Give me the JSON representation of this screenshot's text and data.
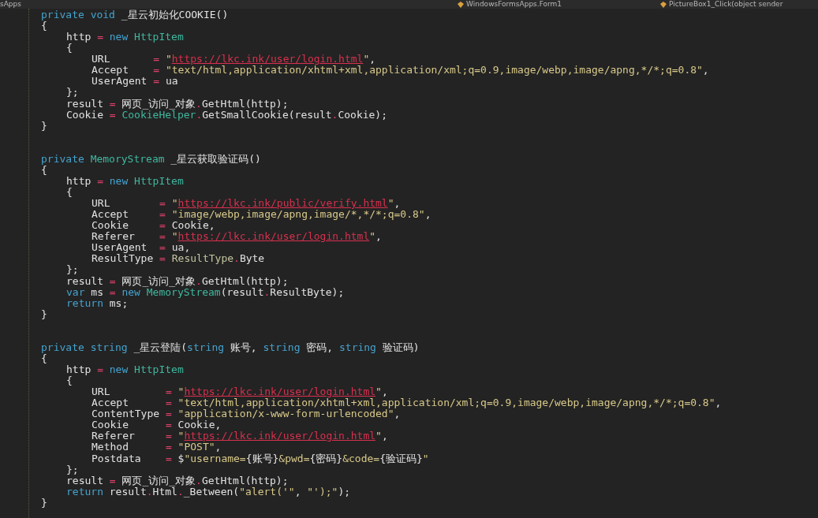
{
  "navigation_bar": [
    {
      "label": "sApps",
      "icon": false
    },
    {
      "label": "WindowsFormsApps.Form1",
      "icon": true
    },
    {
      "label": "PictureBox1_Click(object sender",
      "icon": true
    }
  ],
  "methods": [
    {
      "lines": [
        {
          "tokens": [
            {
              "kind": "kw",
              "text": "private "
            },
            {
              "kind": "kw",
              "text": "void"
            },
            {
              "kind": "plain",
              "text": " _星云初始化COOKIE()"
            }
          ]
        },
        {
          "tokens": [
            {
              "kind": "plain",
              "text": "{"
            }
          ],
          "children": [
            {
              "tokens": [
                {
                  "kind": "plain",
                  "text": "http"
                },
                {
                  "kind": "op",
                  "text": " = "
                },
                {
                  "kind": "kw",
                  "text": "new "
                },
                {
                  "kind": "type",
                  "text": "HttpItem"
                }
              ]
            },
            {
              "tokens": [
                {
                  "kind": "plain",
                  "text": "{"
                }
              ],
              "children": [
                {
                  "tokens": [
                    {
                      "kind": "plain",
                      "text": "URL"
                    },
                    {
                      "kind": "op",
                      "text": "       = "
                    },
                    {
                      "kind": "str",
                      "text": "\""
                    },
                    {
                      "kind": "url",
                      "text": "https://lkc.ink/user/login.html"
                    },
                    {
                      "kind": "str",
                      "text": "\""
                    },
                    {
                      "kind": "plain",
                      "text": ","
                    }
                  ]
                },
                {
                  "tokens": [
                    {
                      "kind": "plain",
                      "text": "Accept"
                    },
                    {
                      "kind": "op",
                      "text": "    = "
                    },
                    {
                      "kind": "str",
                      "text": "\"text/html,application/xhtml+xml,application/xml;q=0.9,image/webp,image/apng,*/*;q=0.8\""
                    },
                    {
                      "kind": "plain",
                      "text": ","
                    }
                  ]
                },
                {
                  "tokens": [
                    {
                      "kind": "plain",
                      "text": "UserAgent"
                    },
                    {
                      "kind": "op",
                      "text": " = "
                    },
                    {
                      "kind": "plain",
                      "text": "ua"
                    }
                  ]
                }
              ]
            },
            {
              "tokens": [
                {
                  "kind": "plain",
                  "text": "};"
                }
              ]
            },
            {
              "tokens": [
                {
                  "kind": "plain",
                  "text": "result"
                },
                {
                  "kind": "op",
                  "text": " = "
                },
                {
                  "kind": "plain",
                  "text": "网页_访问_对象"
                },
                {
                  "kind": "op",
                  "text": "."
                },
                {
                  "kind": "plain",
                  "text": "GetHtml(http);"
                }
              ]
            },
            {
              "tokens": [
                {
                  "kind": "plain",
                  "text": "Cookie"
                },
                {
                  "kind": "op",
                  "text": " = "
                },
                {
                  "kind": "type",
                  "text": "CookieHelper"
                },
                {
                  "kind": "op",
                  "text": "."
                },
                {
                  "kind": "plain",
                  "text": "GetSmallCookie(result"
                },
                {
                  "kind": "op",
                  "text": "."
                },
                {
                  "kind": "plain",
                  "text": "Cookie);"
                }
              ]
            }
          ]
        },
        {
          "tokens": [
            {
              "kind": "plain",
              "text": "}"
            }
          ]
        }
      ]
    },
    {
      "lines": [
        {
          "tokens": [
            {
              "kind": "kw",
              "text": "private "
            },
            {
              "kind": "type",
              "text": "MemoryStream"
            },
            {
              "kind": "plain",
              "text": " _星云获取验证码()"
            }
          ]
        },
        {
          "tokens": [
            {
              "kind": "plain",
              "text": "{"
            }
          ],
          "children": [
            {
              "tokens": [
                {
                  "kind": "plain",
                  "text": "http"
                },
                {
                  "kind": "op",
                  "text": " = "
                },
                {
                  "kind": "kw",
                  "text": "new "
                },
                {
                  "kind": "type",
                  "text": "HttpItem"
                }
              ]
            },
            {
              "tokens": [
                {
                  "kind": "plain",
                  "text": "{"
                }
              ],
              "children": [
                {
                  "tokens": [
                    {
                      "kind": "plain",
                      "text": "URL"
                    },
                    {
                      "kind": "op",
                      "text": "        = "
                    },
                    {
                      "kind": "str",
                      "text": "\""
                    },
                    {
                      "kind": "url",
                      "text": "https://lkc.ink/public/verify.html"
                    },
                    {
                      "kind": "str",
                      "text": "\""
                    },
                    {
                      "kind": "plain",
                      "text": ","
                    }
                  ]
                },
                {
                  "tokens": [
                    {
                      "kind": "plain",
                      "text": "Accept"
                    },
                    {
                      "kind": "op",
                      "text": "     = "
                    },
                    {
                      "kind": "str",
                      "text": "\"image/webp,image/apng,image/*,*/*;q=0.8\""
                    },
                    {
                      "kind": "plain",
                      "text": ","
                    }
                  ]
                },
                {
                  "tokens": [
                    {
                      "kind": "plain",
                      "text": "Cookie"
                    },
                    {
                      "kind": "op",
                      "text": "     = "
                    },
                    {
                      "kind": "plain",
                      "text": "Cookie,"
                    }
                  ]
                },
                {
                  "tokens": [
                    {
                      "kind": "plain",
                      "text": "Referer"
                    },
                    {
                      "kind": "op",
                      "text": "    = "
                    },
                    {
                      "kind": "str",
                      "text": "\""
                    },
                    {
                      "kind": "url",
                      "text": "https://lkc.ink/user/login.html"
                    },
                    {
                      "kind": "str",
                      "text": "\""
                    },
                    {
                      "kind": "plain",
                      "text": ","
                    }
                  ]
                },
                {
                  "tokens": [
                    {
                      "kind": "plain",
                      "text": "UserAgent"
                    },
                    {
                      "kind": "op",
                      "text": "  = "
                    },
                    {
                      "kind": "plain",
                      "text": "ua,"
                    }
                  ]
                },
                {
                  "tokens": [
                    {
                      "kind": "plain",
                      "text": "ResultType"
                    },
                    {
                      "kind": "op",
                      "text": " = "
                    },
                    {
                      "kind": "enum",
                      "text": "ResultType"
                    },
                    {
                      "kind": "op",
                      "text": "."
                    },
                    {
                      "kind": "plain",
                      "text": "Byte"
                    }
                  ]
                }
              ]
            },
            {
              "tokens": [
                {
                  "kind": "plain",
                  "text": "};"
                }
              ]
            },
            {
              "tokens": [
                {
                  "kind": "plain",
                  "text": "result"
                },
                {
                  "kind": "op",
                  "text": " = "
                },
                {
                  "kind": "plain",
                  "text": "网页_访问_对象"
                },
                {
                  "kind": "op",
                  "text": "."
                },
                {
                  "kind": "plain",
                  "text": "GetHtml(http);"
                }
              ]
            },
            {
              "tokens": [
                {
                  "kind": "kw",
                  "text": "var"
                },
                {
                  "kind": "plain",
                  "text": " ms"
                },
                {
                  "kind": "op",
                  "text": " = "
                },
                {
                  "kind": "kw",
                  "text": "new "
                },
                {
                  "kind": "type",
                  "text": "MemoryStream"
                },
                {
                  "kind": "plain",
                  "text": "(result"
                },
                {
                  "kind": "op",
                  "text": "."
                },
                {
                  "kind": "plain",
                  "text": "ResultByte);"
                }
              ]
            },
            {
              "tokens": [
                {
                  "kind": "kw",
                  "text": "return"
                },
                {
                  "kind": "plain",
                  "text": " ms;"
                }
              ]
            }
          ]
        },
        {
          "tokens": [
            {
              "kind": "plain",
              "text": "}"
            }
          ]
        }
      ]
    },
    {
      "lines": [
        {
          "tokens": [
            {
              "kind": "kw",
              "text": "private "
            },
            {
              "kind": "kw",
              "text": "string"
            },
            {
              "kind": "plain",
              "text": " _星云登陆("
            },
            {
              "kind": "kw",
              "text": "string"
            },
            {
              "kind": "plain",
              "text": " 账号, "
            },
            {
              "kind": "kw",
              "text": "string"
            },
            {
              "kind": "plain",
              "text": " 密码, "
            },
            {
              "kind": "kw",
              "text": "string"
            },
            {
              "kind": "plain",
              "text": " 验证码)"
            }
          ]
        },
        {
          "tokens": [
            {
              "kind": "plain",
              "text": "{"
            }
          ],
          "children": [
            {
              "tokens": [
                {
                  "kind": "plain",
                  "text": "http"
                },
                {
                  "kind": "op",
                  "text": " = "
                },
                {
                  "kind": "kw",
                  "text": "new "
                },
                {
                  "kind": "type",
                  "text": "HttpItem"
                }
              ]
            },
            {
              "tokens": [
                {
                  "kind": "plain",
                  "text": "{"
                }
              ],
              "children": [
                {
                  "tokens": [
                    {
                      "kind": "plain",
                      "text": "URL"
                    },
                    {
                      "kind": "op",
                      "text": "         = "
                    },
                    {
                      "kind": "str",
                      "text": "\""
                    },
                    {
                      "kind": "url",
                      "text": "https://lkc.ink/user/login.html"
                    },
                    {
                      "kind": "str",
                      "text": "\""
                    },
                    {
                      "kind": "plain",
                      "text": ","
                    }
                  ]
                },
                {
                  "tokens": [
                    {
                      "kind": "plain",
                      "text": "Accept"
                    },
                    {
                      "kind": "op",
                      "text": "      = "
                    },
                    {
                      "kind": "str",
                      "text": "\"text/html,application/xhtml+xml,application/xml;q=0.9,image/webp,image/apng,*/*;q=0.8\""
                    },
                    {
                      "kind": "plain",
                      "text": ","
                    }
                  ]
                },
                {
                  "tokens": [
                    {
                      "kind": "plain",
                      "text": "ContentType"
                    },
                    {
                      "kind": "op",
                      "text": " = "
                    },
                    {
                      "kind": "str",
                      "text": "\"application/x-www-form-urlencoded\""
                    },
                    {
                      "kind": "plain",
                      "text": ","
                    }
                  ]
                },
                {
                  "tokens": [
                    {
                      "kind": "plain",
                      "text": "Cookie"
                    },
                    {
                      "kind": "op",
                      "text": "      = "
                    },
                    {
                      "kind": "plain",
                      "text": "Cookie,"
                    }
                  ]
                },
                {
                  "tokens": [
                    {
                      "kind": "plain",
                      "text": "Referer"
                    },
                    {
                      "kind": "op",
                      "text": "     = "
                    },
                    {
                      "kind": "str",
                      "text": "\""
                    },
                    {
                      "kind": "url",
                      "text": "https://lkc.ink/user/login.html"
                    },
                    {
                      "kind": "str",
                      "text": "\""
                    },
                    {
                      "kind": "plain",
                      "text": ","
                    }
                  ]
                },
                {
                  "tokens": [
                    {
                      "kind": "plain",
                      "text": "Method"
                    },
                    {
                      "kind": "op",
                      "text": "      = "
                    },
                    {
                      "kind": "str",
                      "text": "\"POST\""
                    },
                    {
                      "kind": "plain",
                      "text": ","
                    }
                  ]
                },
                {
                  "tokens": [
                    {
                      "kind": "plain",
                      "text": "Postdata"
                    },
                    {
                      "kind": "op",
                      "text": "    = "
                    },
                    {
                      "kind": "plain",
                      "text": "$"
                    },
                    {
                      "kind": "str",
                      "text": "\"username="
                    },
                    {
                      "kind": "plain",
                      "text": "{账号}"
                    },
                    {
                      "kind": "str",
                      "text": "&pwd="
                    },
                    {
                      "kind": "plain",
                      "text": "{密码}"
                    },
                    {
                      "kind": "str",
                      "text": "&code="
                    },
                    {
                      "kind": "plain",
                      "text": "{验证码}"
                    },
                    {
                      "kind": "str",
                      "text": "\""
                    }
                  ]
                }
              ]
            },
            {
              "tokens": [
                {
                  "kind": "plain",
                  "text": "};"
                }
              ]
            },
            {
              "tokens": [
                {
                  "kind": "plain",
                  "text": "result"
                },
                {
                  "kind": "op",
                  "text": " = "
                },
                {
                  "kind": "plain",
                  "text": "网页_访问_对象"
                },
                {
                  "kind": "op",
                  "text": "."
                },
                {
                  "kind": "plain",
                  "text": "GetHtml(http);"
                }
              ]
            },
            {
              "tokens": [
                {
                  "kind": "kw",
                  "text": "return"
                },
                {
                  "kind": "plain",
                  "text": " result"
                },
                {
                  "kind": "op",
                  "text": "."
                },
                {
                  "kind": "plain",
                  "text": "Html"
                },
                {
                  "kind": "op",
                  "text": "."
                },
                {
                  "kind": "plain",
                  "text": "_Between("
                },
                {
                  "kind": "str",
                  "text": "\"alert('\""
                },
                {
                  "kind": "plain",
                  "text": ", "
                },
                {
                  "kind": "str",
                  "text": "\"');\""
                },
                {
                  "kind": "plain",
                  "text": ");"
                }
              ]
            }
          ]
        },
        {
          "tokens": [
            {
              "kind": "plain",
              "text": "}"
            }
          ]
        }
      ]
    }
  ]
}
